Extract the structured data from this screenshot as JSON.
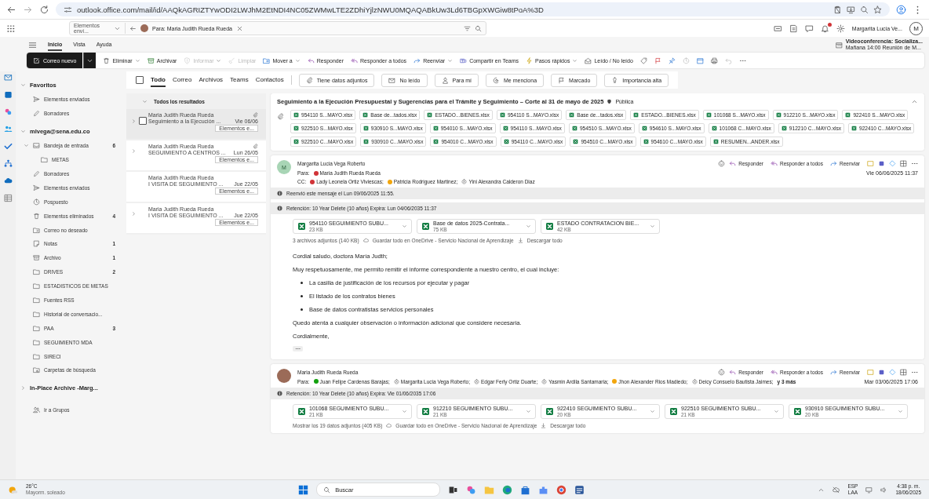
{
  "browser": {
    "url": "outlook.office.com/mail/id/AAQkAGRIZTYwODI2LWJhM2EtNDI4NC05ZWMwLTE2ZDhiYjlzNWU0MQAQABkUw3Ld6TBGpXWGiw8tPoA%3D"
  },
  "header": {
    "folder_scope": "Elementos enví...",
    "search_chip": "Para: Maria Judith Rueda Rueda",
    "user_name": "Margarita Lucia Ve...",
    "user_initial": "M"
  },
  "ribbon_tabs": [
    {
      "label": "Inicio",
      "selected": true
    },
    {
      "label": "Vista",
      "selected": false
    },
    {
      "label": "Ayuda",
      "selected": false
    }
  ],
  "reminder": {
    "title": "Videoconferencia: Socializa...",
    "detail": "Mañana 14:00 Reunión de M..."
  },
  "toolbar": {
    "new_mail": "Correo nuevo",
    "items": [
      {
        "label": "Eliminar",
        "kind": "delete",
        "menu": true,
        "disabled": false
      },
      {
        "label": "Archivar",
        "kind": "archive",
        "menu": false,
        "disabled": false
      },
      {
        "label": "Informar",
        "kind": "report",
        "menu": true,
        "disabled": true
      },
      {
        "label": "Limpiar",
        "kind": "sweep",
        "menu": false,
        "disabled": true
      },
      {
        "label": "Mover a",
        "kind": "move",
        "menu": true,
        "disabled": false
      },
      {
        "label": "Responder",
        "kind": "reply",
        "menu": false,
        "disabled": false
      },
      {
        "label": "Responder a todos",
        "kind": "reply-all",
        "menu": false,
        "disabled": false
      },
      {
        "label": "Reenviar",
        "kind": "forward",
        "menu": true,
        "disabled": false
      },
      {
        "label": "Compartir en Teams",
        "kind": "teams",
        "menu": false,
        "disabled": false
      },
      {
        "label": "Pasos rápidos",
        "kind": "quick",
        "menu": true,
        "disabled": false
      },
      {
        "label": "Leído / No leído",
        "kind": "read",
        "menu": false,
        "disabled": false
      }
    ]
  },
  "folders": {
    "sections": [
      {
        "label": "Favoritos",
        "expanded": true,
        "items": [
          {
            "label": "Elementos enviados",
            "kind": "sent"
          },
          {
            "label": "Borradores",
            "kind": "draft"
          }
        ]
      },
      {
        "label": "mlvega@sena.edu.co",
        "expanded": true,
        "items": [
          {
            "label": "Bandeja de entrada",
            "kind": "inbox",
            "count": "6",
            "expanded": true,
            "children": [
              {
                "label": "METAS",
                "kind": "folder"
              }
            ]
          },
          {
            "label": "Borradores",
            "kind": "draft"
          },
          {
            "label": "Elementos enviados",
            "kind": "sent"
          },
          {
            "label": "Pospuesto",
            "kind": "clock"
          },
          {
            "label": "Elementos eliminados",
            "kind": "trash",
            "count": "4"
          },
          {
            "label": "Correo no deseado",
            "kind": "junk"
          },
          {
            "label": "Notas",
            "kind": "notes",
            "count": "1"
          },
          {
            "label": "Archivo",
            "kind": "archive",
            "count": "1"
          },
          {
            "label": "DRIVES",
            "kind": "folder",
            "count": "2"
          },
          {
            "label": "ESTADISTICOS DE METAS",
            "kind": "folder"
          },
          {
            "label": "Fuentes RSS",
            "kind": "folder"
          },
          {
            "label": "Historial de conversacio...",
            "kind": "folder"
          },
          {
            "label": "PAA",
            "kind": "folder",
            "count": "3"
          },
          {
            "label": "SEGUIMIENTO MDA",
            "kind": "folder"
          },
          {
            "label": "SIRECI",
            "kind": "folder"
          },
          {
            "label": "Carpetas de búsqueda",
            "kind": "search-folder"
          }
        ]
      },
      {
        "label": "In-Place Archive -Marg...",
        "expanded": false
      }
    ],
    "groups_link": "Ir a Grupos"
  },
  "select_all_checked": false,
  "search_tabs": [
    {
      "label": "Todo",
      "selected": true
    },
    {
      "label": "Correo",
      "selected": false
    },
    {
      "label": "Archivos",
      "selected": false
    },
    {
      "label": "Teams",
      "selected": false
    },
    {
      "label": "Contactos",
      "selected": false
    }
  ],
  "filters": [
    {
      "label": "Tiene datos adjuntos",
      "kind": "clip"
    },
    {
      "label": "No leído",
      "kind": "unread"
    },
    {
      "label": "Para mí",
      "kind": "person"
    },
    {
      "label": "Me menciona",
      "kind": "at"
    },
    {
      "label": "Marcado",
      "kind": "flag"
    },
    {
      "label": "Importancia alta",
      "kind": "important"
    }
  ],
  "message_list": {
    "header": "Todos los resultados",
    "items": [
      {
        "sender": "Maria Judith Rueda Rueda",
        "subject": "Seguimiento a la Ejecución ...",
        "date": "Vie 06/06",
        "folder": "Elementos e...",
        "attachment": true,
        "thread": true,
        "selected": true
      },
      {
        "sender": "Maria Judith Rueda Rueda",
        "subject": "SEGUIMIENTO A CENTROS ...",
        "date": "Lun 26/05",
        "folder": "Elementos e...",
        "attachment": true,
        "thread": true,
        "selected": false
      },
      {
        "sender": "Maria Judith Rueda Rueda",
        "subject": "I VISITA DE SEGUIMIENTO ...",
        "date": "Jue 22/05",
        "folder": "Elementos e...",
        "attachment": false,
        "thread": false,
        "selected": false
      },
      {
        "sender": "Maria Judith Rueda Rueda",
        "subject": "I VISITA DE SEGUIMIENTO ...",
        "date": "Jue 22/05",
        "folder": "Elementos e...",
        "attachment": false,
        "thread": true,
        "selected": false
      }
    ]
  },
  "reading": {
    "subject": "Seguimiento a la Ejecución Presupuestal y Sugerencias para el Trámite y Seguimiento – Corte al 31 de mayo de 2025",
    "sensitivity": "Pública",
    "attachments": [
      "954110 S...MAYO.xlsx",
      "Base de...tados.xlsx",
      "ESTADO...BIENES.xlsx",
      "954110 S...MAYO.xlsx",
      "Base de...tados.xlsx",
      "ESTADO...BIENES.xlsx",
      "101068 S...MAYO.xlsx",
      "912210 S...MAYO.xlsx",
      "922410 S...MAYO.xlsx",
      "922510 S...MAYO.xlsx",
      "930910 S...MAYO.xlsx",
      "954010 S...MAYO.xlsx",
      "954110 S...MAYO.xlsx",
      "954510 S...MAYO.xlsx",
      "954610 S...MAYO.xlsx",
      "101068 C...MAYO.xlsx",
      "912210 C...MAYO.xlsx",
      "922410 C...MAYO.xlsx",
      "922510 C...MAYO.xlsx",
      "930910 C...MAYO.xlsx",
      "954010 C...MAYO.xlsx",
      "954110 C...MAYO.xlsx",
      "954510 C...MAYO.xlsx",
      "954610 C...MAYO.xlsx",
      "RESUMEN...ANDER.xlsx"
    ],
    "messages": [
      {
        "sender": "Margarita Lucia Vega Roberto",
        "initial": "M",
        "to_label": "Para:",
        "to": [
          {
            "name": "Maria Judith Rueda Rueda",
            "color": "#d13438"
          }
        ],
        "cc_label": "CC:",
        "cc": [
          {
            "name": "Lady Leonela Ortiz Viviescas;",
            "color": "#d13438"
          },
          {
            "name": "Patricia Rodriguez Martinez;",
            "color": "#f2a60d"
          },
          {
            "name": "Yini Alexandra Calderon Diaz"
          }
        ],
        "date": "Vie 06/06/2025 11:37",
        "actions": [
          {
            "label": "Responder",
            "kind": "reply"
          },
          {
            "label": "Responder a todos",
            "kind": "reply-all"
          },
          {
            "label": "Reenviar",
            "kind": "forward"
          }
        ],
        "notices": [
          "Reenvió este mensaje el Lun 09/06/2025 11:55.",
          "Retención: 10 Year Delete (10 años) Expira: Lun 04/06/2035 11:37"
        ],
        "files": [
          {
            "name": "954110 SEGUIMIENTO SUBU...",
            "size": "23 KB"
          },
          {
            "name": "Base de datos 2025-Contrata...",
            "size": "75 KB"
          },
          {
            "name": "ESTADO CONTRATACION BIE...",
            "size": "42 KB"
          }
        ],
        "files_summary": "3 archivos adjuntos (140 KB)",
        "save_all": "Guardar todo en OneDrive - Servicio Nacional de Aprendizaje",
        "download_all": "Descargar todo",
        "body": [
          {
            "kind": "paragraph",
            "text": "Cordial saludo, doctora María Judth;"
          },
          {
            "kind": "paragraph",
            "text": "Muy respetuosamente, me permito remitir el informe correspondiente a nuestro centro, el cual incluye:"
          },
          {
            "kind": "bullet",
            "text": "La casilla de justificación de los recursos por ejecutar y pagar"
          },
          {
            "kind": "bullet",
            "text": "El listado de los contratos bienes"
          },
          {
            "kind": "bullet",
            "text": "Base de datos  contratistas servicios personales"
          },
          {
            "kind": "paragraph",
            "text": "Quedo atenta a cualquier observación o información adicional que considere necesaria."
          },
          {
            "kind": "paragraph",
            "text": "Cordialmente,"
          }
        ],
        "collapsed_quote": true
      },
      {
        "sender": "Maria Judith Rueda Rueda",
        "to_label": "Para:",
        "to": [
          {
            "name": "Juan Felipe Cardenas Barajas;",
            "color": "#13a10e"
          },
          {
            "name": "Margarita Lucia Vega Roberto;"
          },
          {
            "name": "Edgar Ferly Ortiz Duarte;"
          },
          {
            "name": "Yasmin Ardila Santamaria;"
          },
          {
            "name": "Jhon Alexander Rios Madiedo;",
            "color": "#f2a60d"
          },
          {
            "name": "Deicy Consuelo Bautista Jaimes;"
          }
        ],
        "more": "y 3 más",
        "date": "Mar 03/06/2025 17:06",
        "actions": [
          {
            "label": "Responder",
            "kind": "reply"
          },
          {
            "label": "Responder a todos",
            "kind": "reply-all"
          },
          {
            "label": "Reenviar",
            "kind": "forward"
          }
        ],
        "notices": [
          "Retención: 10 Year Delete (10 años) Expira: Vie 01/06/2035 17:06"
        ],
        "files": [
          {
            "name": "101068 SEGUIMIENTO SUBU...",
            "size": "21 KB"
          },
          {
            "name": "912210 SEGUIMIENTO SUBU...",
            "size": "21 KB"
          },
          {
            "name": "922410 SEGUIMIENTO SUBU...",
            "size": "20 KB"
          },
          {
            "name": "922510 SEGUIMIENTO SUBU...",
            "size": "21 KB"
          },
          {
            "name": "930910 SEGUIMIENTO SUBU...",
            "size": "20 KB"
          }
        ],
        "files_summary": "Mostrar los 19 datos adjuntos (405 KB)",
        "save_all": "Guardar todo en OneDrive - Servicio Nacional de Aprendizaje",
        "download_all": "Descargar todo"
      }
    ]
  },
  "taskbar": {
    "temperature": "26°C",
    "weather": "Mayorm. soleado",
    "search": "Buscar",
    "language": "ESP",
    "layout": "LAA",
    "time": "4:38 p. m.",
    "date": "18/06/2025"
  }
}
